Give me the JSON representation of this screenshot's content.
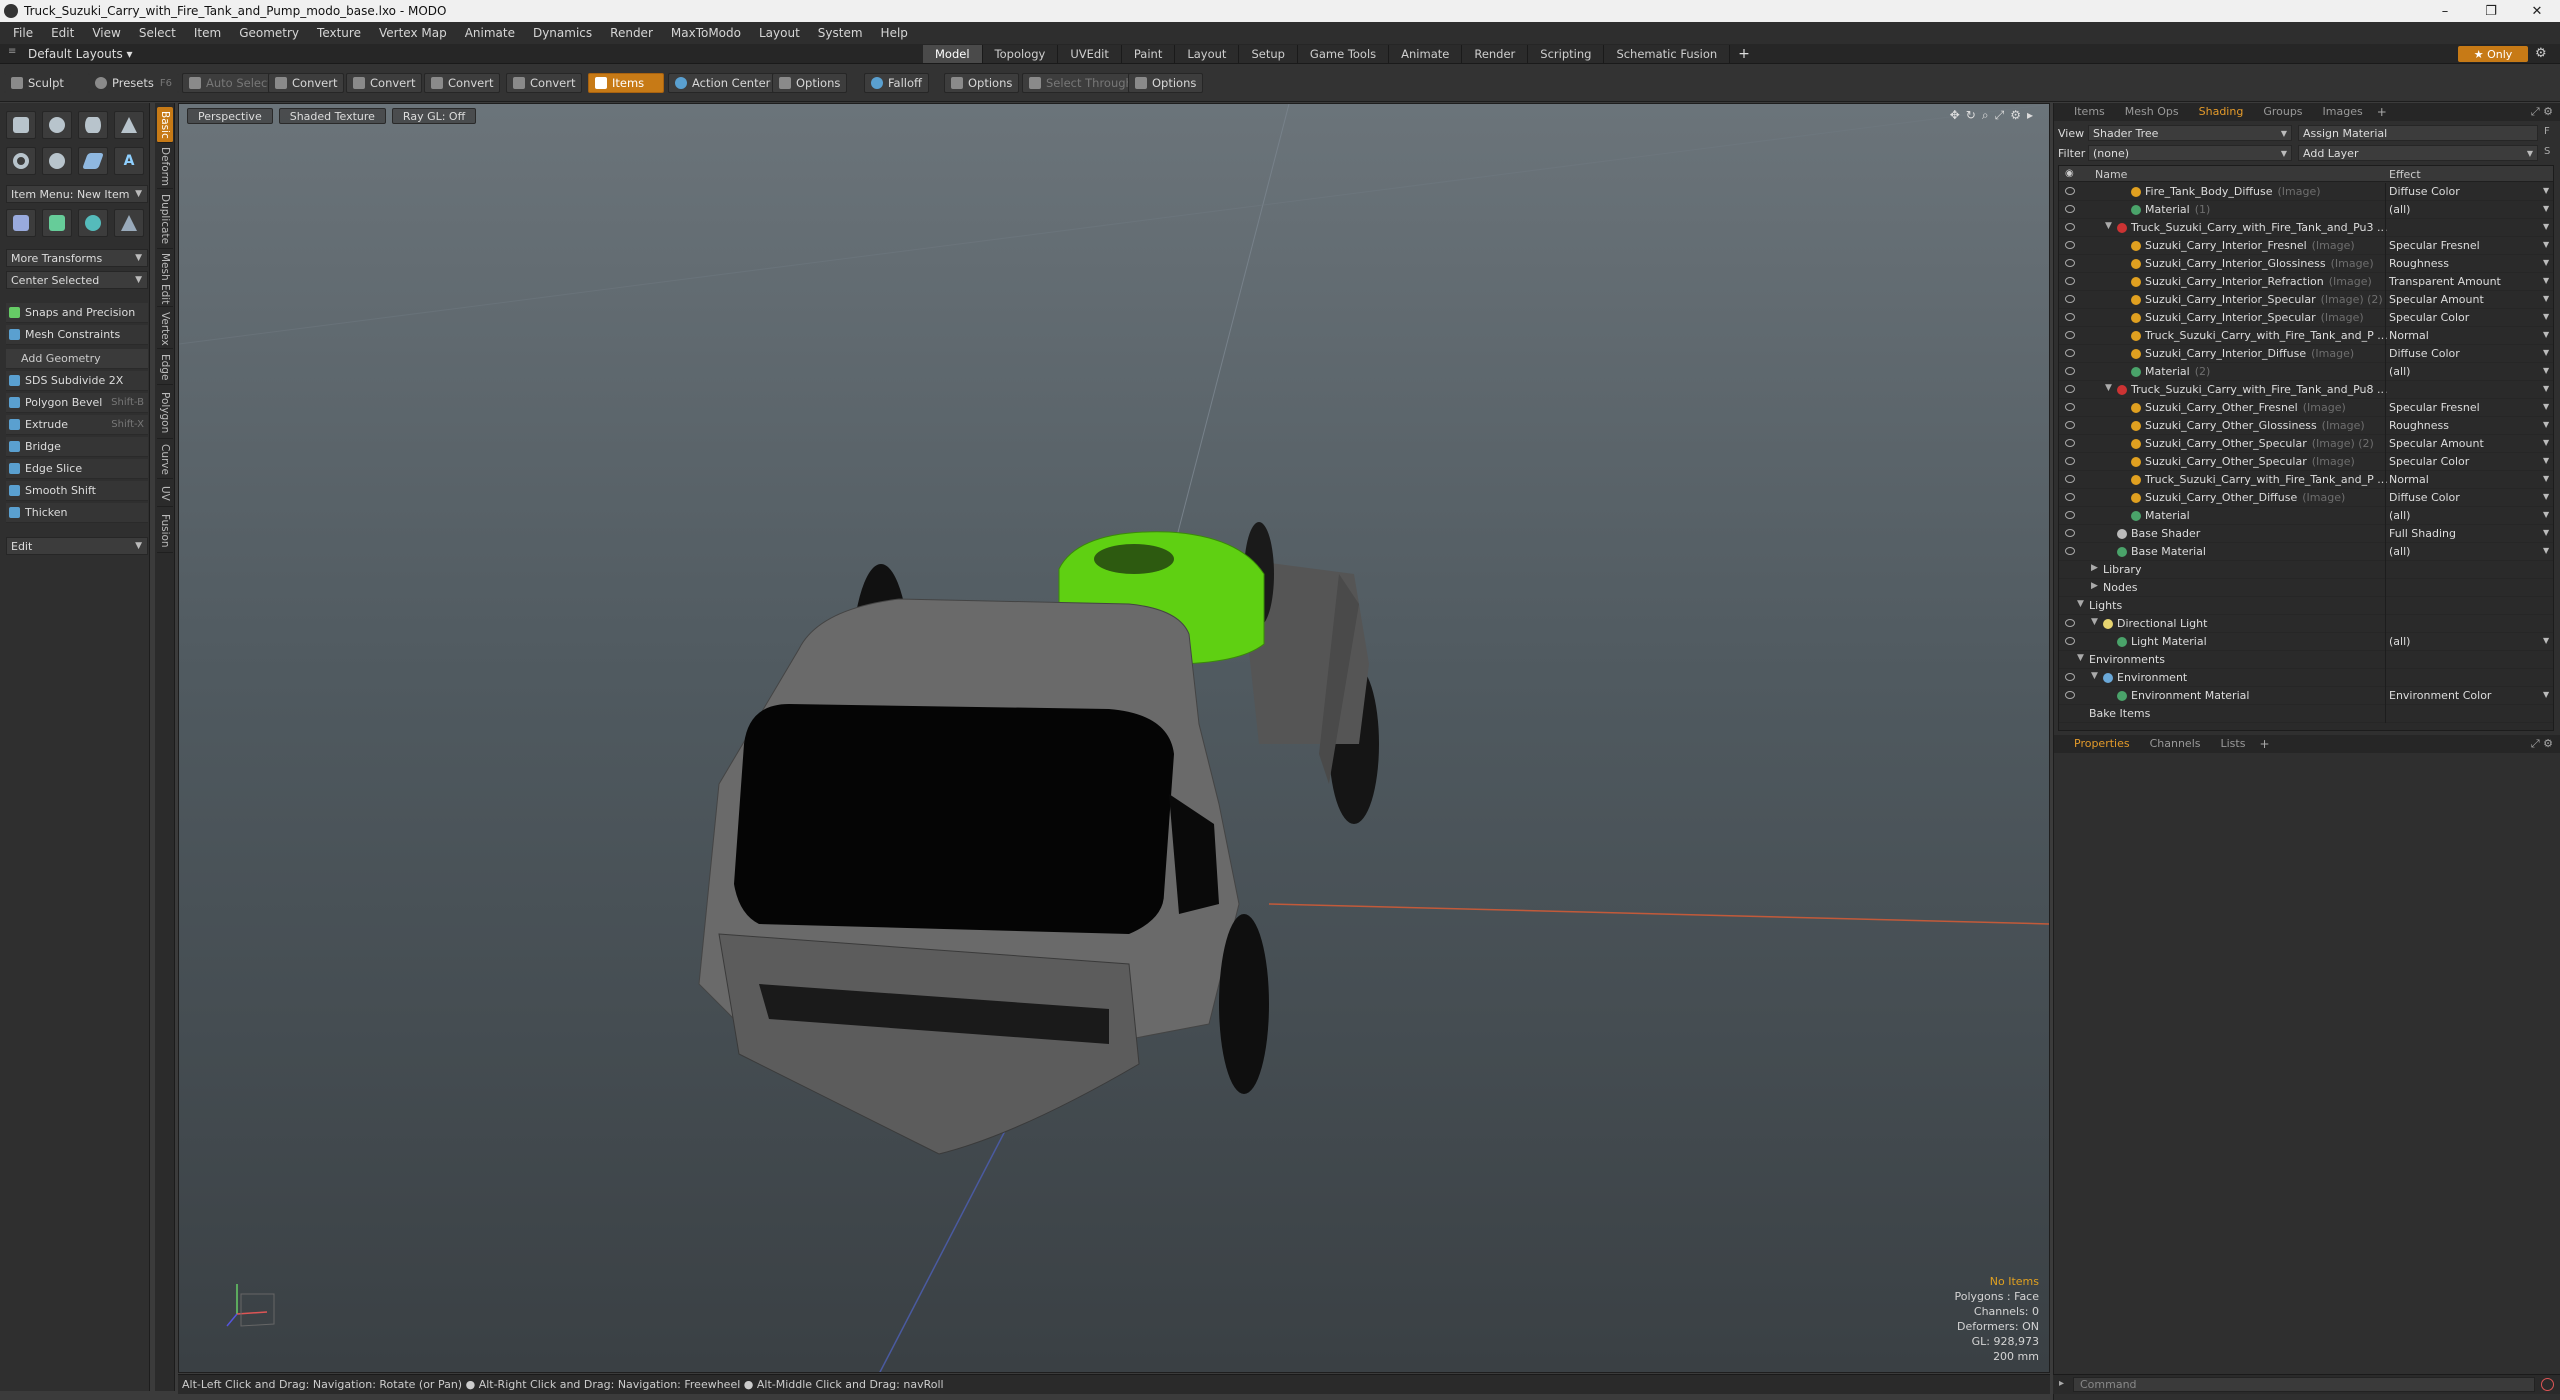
{
  "window": {
    "title": "Truck_Suzuki_Carry_with_Fire_Tank_and_Pump_modo_base.lxo - MODO",
    "minimize": "–",
    "maximize": "❐",
    "close": "✕"
  },
  "menu": [
    "File",
    "Edit",
    "View",
    "Select",
    "Item",
    "Geometry",
    "Texture",
    "Vertex Map",
    "Animate",
    "Dynamics",
    "Render",
    "MaxToModo",
    "Layout",
    "System",
    "Help"
  ],
  "layouts": {
    "label": "Default Layouts ▾"
  },
  "mode_tabs": [
    {
      "label": "Model",
      "active": true
    },
    {
      "label": "Topology"
    },
    {
      "label": "UVEdit"
    },
    {
      "label": "Paint"
    },
    {
      "label": "Layout"
    },
    {
      "label": "Setup"
    },
    {
      "label": "Game Tools"
    },
    {
      "label": "Animate"
    },
    {
      "label": "Render"
    },
    {
      "label": "Scripting"
    },
    {
      "label": "Schematic Fusion"
    }
  ],
  "mode_add": "+",
  "only_label": "★ Only",
  "toolbar": {
    "sculpt": "Sculpt",
    "presets": "Presets",
    "presets_sc": "F6",
    "auto_select": "Auto Select",
    "convert1": "Convert",
    "convert2": "Convert",
    "convert3": "Convert",
    "convert4": "Convert",
    "items": "Items",
    "action_center": "Action Center",
    "options1": "Options",
    "falloff": "Falloff",
    "options2": "Options",
    "select_through": "Select Through",
    "options3": "Options"
  },
  "left": {
    "item_menu": "Item Menu: New Item",
    "more_transforms": "More Transforms",
    "center_selected": "Center Selected",
    "snaps": "Snaps and Precision",
    "mesh_constraints": "Mesh Constraints",
    "add_geometry": "Add Geometry",
    "tools": [
      {
        "label": "SDS Subdivide 2X",
        "sc": ""
      },
      {
        "label": "Polygon Bevel",
        "sc": "Shift-B"
      },
      {
        "label": "Extrude",
        "sc": "Shift-X"
      },
      {
        "label": "Bridge",
        "sc": ""
      },
      {
        "label": "Edge Slice",
        "sc": ""
      },
      {
        "label": "Smooth Shift",
        "sc": ""
      },
      {
        "label": "Thicken",
        "sc": ""
      }
    ],
    "edit": "Edit"
  },
  "side_tabs": [
    "Basic",
    "Deform",
    "Duplicate",
    "Mesh Edit",
    "Vertex",
    "Edge",
    "Polygon",
    "Curve",
    "UV",
    "Fusion"
  ],
  "viewport": {
    "perspective": "Perspective",
    "shaded_texture": "Shaded Texture",
    "raygl": "Ray GL: Off",
    "stats": {
      "no_items": "No Items",
      "polygons": "Polygons : Face",
      "channels": "Channels: 0",
      "deformers": "Deformers: ON",
      "gl": "GL: 928,973",
      "scale": "200 mm"
    }
  },
  "status": "Alt-Left Click and Drag: Navigation: Rotate (or Pan) ● Alt-Right Click and Drag: Navigation: Freewheel ● Alt-Middle Click and Drag: navRoll",
  "right": {
    "top_tabs": [
      "Items",
      "Mesh Ops",
      "Shading",
      "Groups",
      "Images"
    ],
    "top_tabs_active": "Shading",
    "view_label": "View",
    "view_value": "Shader Tree",
    "assign_material": "Assign Material",
    "filter_label": "Filter",
    "filter_value": "(none)",
    "add_layer": "Add Layer",
    "col_name": "Name",
    "col_effect": "Effect",
    "tree": [
      {
        "indent": 3,
        "name": "Fire_Tank_Body_Diffuse",
        "tag": "(Image)",
        "effect": "Diffuse Color",
        "icon": "image",
        "arr": true
      },
      {
        "indent": 3,
        "name": "Material",
        "tag": "(1)",
        "effect": "(all)",
        "icon": "mat",
        "arr": true
      },
      {
        "indent": 2,
        "exp": "▼",
        "name": "Truck_Suzuki_Carry_with_Fire_Tank_and_Pu3 ...",
        "tag": "",
        "effect": "",
        "icon": "group",
        "arr": true
      },
      {
        "indent": 3,
        "name": "Suzuki_Carry_Interior_Fresnel",
        "tag": "(Image)",
        "effect": "Specular Fresnel",
        "icon": "image",
        "arr": true
      },
      {
        "indent": 3,
        "name": "Suzuki_Carry_Interior_Glossiness",
        "tag": "(Image)",
        "effect": "Roughness",
        "icon": "image",
        "arr": true
      },
      {
        "indent": 3,
        "name": "Suzuki_Carry_Interior_Refraction",
        "tag": "(Image)",
        "effect": "Transparent Amount",
        "icon": "image",
        "arr": true
      },
      {
        "indent": 3,
        "name": "Suzuki_Carry_Interior_Specular",
        "tag": "(Image) (2)",
        "effect": "Specular Amount",
        "icon": "image",
        "arr": true
      },
      {
        "indent": 3,
        "name": "Suzuki_Carry_Interior_Specular",
        "tag": "(Image)",
        "effect": "Specular Color",
        "icon": "image",
        "arr": true
      },
      {
        "indent": 3,
        "name": "Truck_Suzuki_Carry_with_Fire_Tank_and_P ...",
        "tag": "",
        "effect": "Normal",
        "icon": "image",
        "arr": true
      },
      {
        "indent": 3,
        "name": "Suzuki_Carry_Interior_Diffuse",
        "tag": "(Image)",
        "effect": "Diffuse Color",
        "icon": "image",
        "arr": true
      },
      {
        "indent": 3,
        "name": "Material",
        "tag": "(2)",
        "effect": "(all)",
        "icon": "mat",
        "arr": true
      },
      {
        "indent": 2,
        "exp": "▼",
        "name": "Truck_Suzuki_Carry_with_Fire_Tank_and_Pu8 ...",
        "tag": "",
        "effect": "",
        "icon": "group",
        "arr": true
      },
      {
        "indent": 3,
        "name": "Suzuki_Carry_Other_Fresnel",
        "tag": "(Image)",
        "effect": "Specular Fresnel",
        "icon": "image",
        "arr": true
      },
      {
        "indent": 3,
        "name": "Suzuki_Carry_Other_Glossiness",
        "tag": "(Image)",
        "effect": "Roughness",
        "icon": "image",
        "arr": true
      },
      {
        "indent": 3,
        "name": "Suzuki_Carry_Other_Specular",
        "tag": "(Image) (2)",
        "effect": "Specular Amount",
        "icon": "image",
        "arr": true
      },
      {
        "indent": 3,
        "name": "Suzuki_Carry_Other_Specular",
        "tag": "(Image)",
        "effect": "Specular Color",
        "icon": "image",
        "arr": true
      },
      {
        "indent": 3,
        "name": "Truck_Suzuki_Carry_with_Fire_Tank_and_P ...",
        "tag": "",
        "effect": "Normal",
        "icon": "image",
        "arr": true
      },
      {
        "indent": 3,
        "name": "Suzuki_Carry_Other_Diffuse",
        "tag": "(Image)",
        "effect": "Diffuse Color",
        "icon": "image",
        "arr": true
      },
      {
        "indent": 3,
        "name": "Material",
        "tag": "",
        "effect": "(all)",
        "icon": "mat",
        "arr": true
      },
      {
        "indent": 2,
        "name": "Base Shader",
        "tag": "",
        "effect": "Full Shading",
        "icon": "shader",
        "arr": true
      },
      {
        "indent": 2,
        "name": "Base Material",
        "tag": "",
        "effect": "(all)",
        "icon": "mat",
        "arr": true
      },
      {
        "indent": 1,
        "exp": "▶",
        "name": "Library",
        "tag": "",
        "effect": "",
        "icon": "none",
        "noeye": true
      },
      {
        "indent": 1,
        "exp": "▶",
        "name": "Nodes",
        "tag": "",
        "effect": "",
        "icon": "none",
        "noeye": true
      },
      {
        "indent": 0,
        "exp": "▼",
        "name": "Lights",
        "tag": "",
        "effect": "",
        "icon": "none",
        "noeye": true
      },
      {
        "indent": 1,
        "exp": "▼",
        "name": "Directional Light",
        "tag": "",
        "effect": "",
        "icon": "light"
      },
      {
        "indent": 2,
        "name": "Light Material",
        "tag": "",
        "effect": "(all)",
        "icon": "mat",
        "arr": true
      },
      {
        "indent": 0,
        "exp": "▼",
        "name": "Environments",
        "tag": "",
        "effect": "",
        "icon": "none",
        "noeye": true
      },
      {
        "indent": 1,
        "exp": "▼",
        "name": "Environment",
        "tag": "",
        "effect": "",
        "icon": "env"
      },
      {
        "indent": 2,
        "name": "Environment Material",
        "tag": "",
        "effect": "Environment Color",
        "icon": "mat",
        "arr": true
      },
      {
        "indent": 0,
        "name": "Bake Items",
        "tag": "",
        "effect": "",
        "icon": "none",
        "noeye": true
      }
    ],
    "bottom_tabs": [
      "Properties",
      "Channels",
      "Lists"
    ],
    "bottom_tabs_active": "Properties",
    "command_placeholder": "Command"
  },
  "colors": {
    "accent": "#c77a16",
    "tank_green": "#5fd012"
  }
}
